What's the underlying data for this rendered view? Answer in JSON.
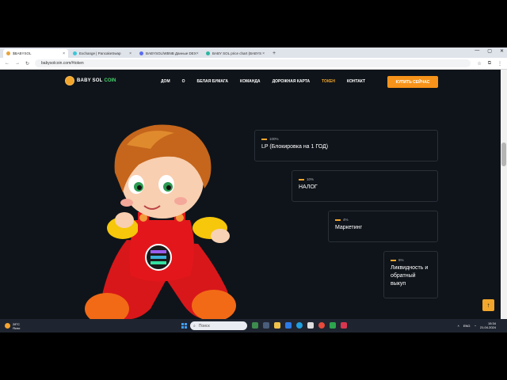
{
  "browser": {
    "tabs": [
      {
        "label": "$BABYSOL",
        "active": true
      },
      {
        "label": "Exchange | PancakeSwap",
        "active": false
      },
      {
        "label": "BABYSOL/WBNB Данные DEX",
        "active": false
      },
      {
        "label": "BABY SOL price chart (BABYS",
        "active": false
      }
    ],
    "new_tab": "+",
    "window_controls": [
      "—",
      "▢",
      "✕"
    ],
    "url": "babysolcoin.com/#token",
    "nav": [
      "←",
      "→",
      "↻"
    ],
    "tools": [
      "☆",
      "⧉",
      "⋮"
    ]
  },
  "site": {
    "logo_text": "BABY SOL",
    "logo_accent": "COIN",
    "menu": [
      {
        "label": "ДОМ",
        "active": false
      },
      {
        "label": "О",
        "active": false
      },
      {
        "label": "БЕЛАЯ БУМАГА",
        "active": false
      },
      {
        "label": "КОМАНДА",
        "active": false
      },
      {
        "label": "ДОРОЖНАЯ КАРТА",
        "active": false
      },
      {
        "label": "ТОКЕН",
        "active": true
      },
      {
        "label": "КОНТАКТ",
        "active": false
      }
    ],
    "buy_button": "КУПИТЬ СЕЙЧАС",
    "accent_color": "#f2a62b",
    "cards": [
      {
        "pct": "100%",
        "label": "LP (Блокировка на 1 ГОД)"
      },
      {
        "pct": "10%",
        "label": "НАЛОГ"
      },
      {
        "pct": "4%",
        "label": "Маркетинг"
      },
      {
        "pct": "6%",
        "label": "Ликвидность и обратный выкуп"
      }
    ],
    "back_to_top": "↑"
  },
  "taskbar": {
    "weather_temp": "28°C",
    "weather_desc": "Ясно",
    "search_placeholder": "Поиск",
    "lang": "ENG",
    "time": "15:34",
    "date": "21.04.2024"
  }
}
